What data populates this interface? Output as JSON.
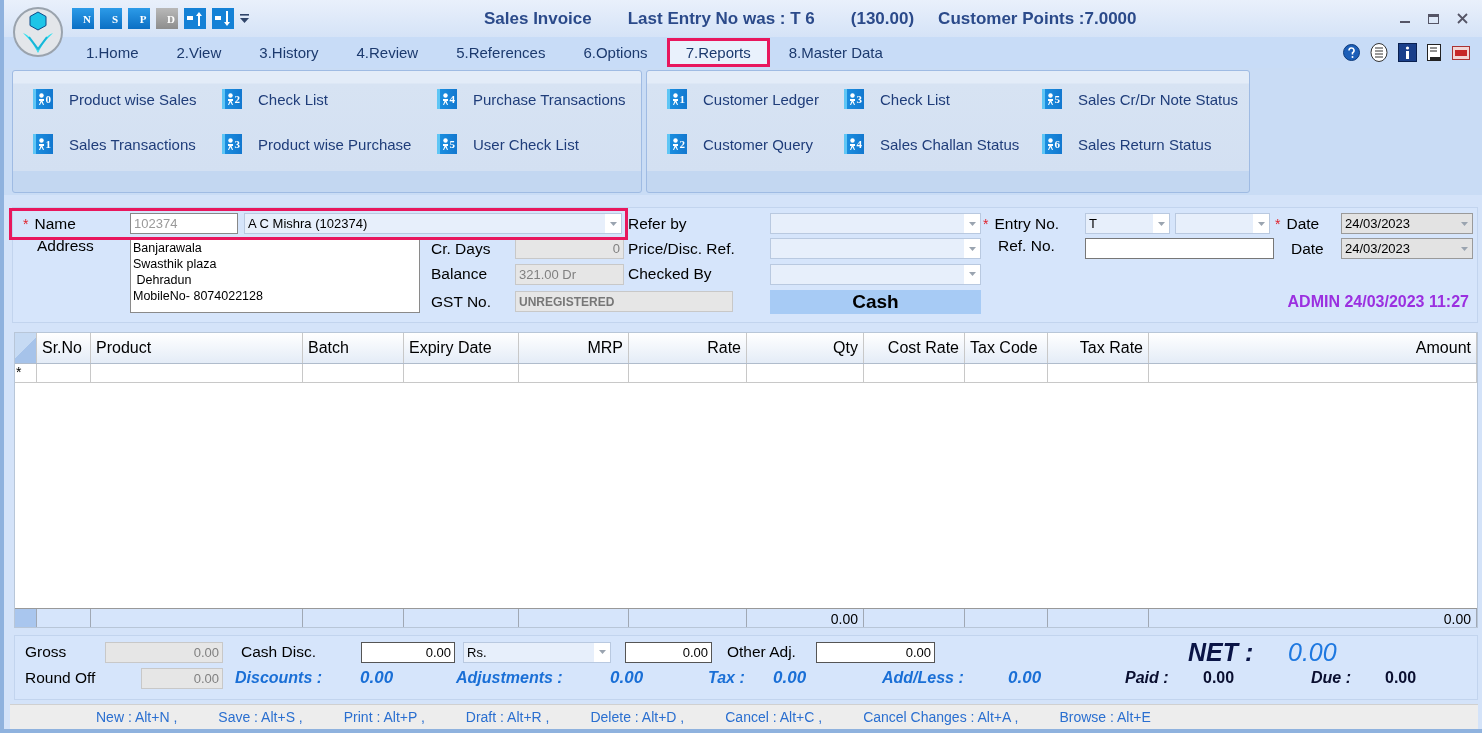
{
  "quick_access": [
    {
      "kind": "letter",
      "label": "N",
      "disabled": false
    },
    {
      "kind": "letter",
      "label": "S",
      "disabled": false
    },
    {
      "kind": "letter",
      "label": "P",
      "disabled": false
    },
    {
      "kind": "letter",
      "label": "D",
      "disabled": true
    },
    {
      "kind": "up",
      "disabled": false
    },
    {
      "kind": "down",
      "disabled": false
    }
  ],
  "title": {
    "text": "Sales Invoice",
    "last_entry": "Last Entry No was : T 6",
    "amount": "(130.00)",
    "points": "Customer Points :7.0000"
  },
  "tabs": [
    {
      "label": "1.Home",
      "selected": false
    },
    {
      "label": "2.View",
      "selected": false
    },
    {
      "label": "3.History",
      "selected": false
    },
    {
      "label": "4.Review",
      "selected": false
    },
    {
      "label": "5.References",
      "selected": false
    },
    {
      "label": "6.Options",
      "selected": false
    },
    {
      "label": "7.Reports",
      "selected": true
    },
    {
      "label": "8.Master Data",
      "selected": false
    }
  ],
  "ribbon_groups": [
    {
      "items": [
        {
          "label": "Product wise Sales",
          "number": "0"
        },
        {
          "label": "Check List",
          "number": "2"
        },
        {
          "label": "Purchase Transactions",
          "number": "4"
        },
        {
          "label": "Sales Transactions",
          "number": "1"
        },
        {
          "label": "Product wise Purchase",
          "number": "3"
        },
        {
          "label": "User Check List",
          "number": "5"
        }
      ]
    },
    {
      "items": [
        {
          "label": "Customer Ledger",
          "number": "1"
        },
        {
          "label": "Check List",
          "number": "3"
        },
        {
          "label": "Sales Cr/Dr Note Status",
          "number": "5"
        },
        {
          "label": "Customer Query",
          "number": "2"
        },
        {
          "label": "Sales Challan Status",
          "number": "4"
        },
        {
          "label": "Sales Return Status",
          "number": "6"
        }
      ]
    }
  ],
  "form": {
    "name": {
      "label": "Name",
      "required": true,
      "highlighted": true,
      "code": "102374",
      "value": "A C Mishra (102374)"
    },
    "address": {
      "label": "Address",
      "lines": [
        "Banjarawala",
        "Swasthik plaza",
        " Dehradun",
        "MobileNo- 8074022128"
      ]
    },
    "cr_days": {
      "label": "Cr. Days",
      "value": "0"
    },
    "balance": {
      "label": "Balance",
      "value": "321.00 Dr"
    },
    "gst_no": {
      "label": "GST No.",
      "value": "UNREGISTERED"
    },
    "refer_by": {
      "label": "Refer by"
    },
    "price_disc_ref": {
      "label": "Price/Disc. Ref."
    },
    "checked_by": {
      "label": "Checked By"
    },
    "payment_mode": "Cash",
    "entry_no": {
      "label": "Entry No.",
      "required": true,
      "series": "T"
    },
    "date": {
      "label": "Date",
      "required": true,
      "value": "24/03/2023"
    },
    "ref_no": {
      "label": "Ref. No."
    },
    "ref_date": {
      "label": "Date",
      "value": "24/03/2023"
    },
    "stamp": "ADMIN 24/03/2023 11:27"
  },
  "grid": {
    "columns": [
      {
        "label": "Sr.No",
        "numeric": false
      },
      {
        "label": "Product",
        "numeric": false
      },
      {
        "label": "Batch",
        "numeric": false
      },
      {
        "label": "Expiry Date",
        "numeric": false
      },
      {
        "label": "MRP",
        "numeric": true
      },
      {
        "label": "Rate",
        "numeric": true
      },
      {
        "label": "Qty",
        "numeric": true,
        "total": "0.00"
      },
      {
        "label": "Cost Rate",
        "numeric": true
      },
      {
        "label": "Tax Code",
        "numeric": false
      },
      {
        "label": "Tax Rate",
        "numeric": true
      },
      {
        "label": "Amount",
        "numeric": true,
        "total": "0.00"
      }
    ],
    "new_row_marker": "*"
  },
  "totals": {
    "gross": {
      "label": "Gross",
      "value": "0.00"
    },
    "cash_disc": {
      "label": "Cash Disc.",
      "value": "0.00",
      "unit": "Rs.",
      "unit_value": "0.00"
    },
    "other_adj": {
      "label": "Other Adj.",
      "value": "0.00"
    },
    "net": {
      "label": "NET :",
      "value": "0.00"
    },
    "round_off": {
      "label": "Round Off",
      "value": "0.00"
    },
    "summary": [
      {
        "label": "Discounts :",
        "value": "0.00"
      },
      {
        "label": "Adjustments :",
        "value": "0.00"
      },
      {
        "label": "Tax :",
        "value": "0.00"
      },
      {
        "label": "Add/Less :",
        "value": "0.00"
      }
    ],
    "paid": {
      "label": "Paid :",
      "value": "0.00"
    },
    "due": {
      "label": "Due :",
      "value": "0.00"
    }
  },
  "shortcuts": [
    "New : Alt+N ,",
    "Save : Alt+S ,",
    "Print : Alt+P ,",
    "Draft : Alt+R ,",
    "Delete : Alt+D ,",
    "Cancel : Alt+C ,",
    "Cancel Changes : Alt+A ,",
    "Browse : Alt+E"
  ]
}
